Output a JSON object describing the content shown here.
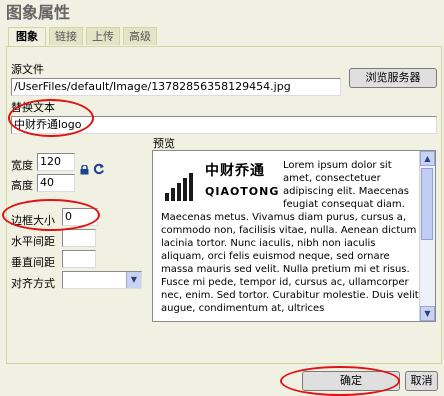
{
  "dialog": {
    "title": "图象属性",
    "tabs": [
      "图象",
      "链接",
      "上传",
      "高级"
    ]
  },
  "image_tab": {
    "source_label": "源文件",
    "source_value": "/UserFiles/default/Image/13782856358129454.jpg",
    "browse_button": "浏览服务器",
    "alt_label": "替换文本",
    "alt_value": "中财乔通logo",
    "width_label": "宽度",
    "width_value": "120",
    "height_label": "高度",
    "height_value": "40",
    "border_label": "边框大小",
    "border_value": "0",
    "hspace_label": "水平间距",
    "hspace_value": "",
    "vspace_label": "垂直间距",
    "vspace_value": "",
    "align_label": "对齐方式",
    "align_value": "",
    "preview_label": "预览"
  },
  "preview": {
    "logo_cn": "中财乔通",
    "logo_en": "QIAOTONG",
    "text": "Lorem ipsum dolor sit amet, consectetuer adipiscing elit. Maecenas feugiat consequat diam. Maecenas metus. Vivamus diam purus, cursus a, commodo non, facilisis vitae, nulla. Aenean dictum lacinia tortor. Nunc iaculis, nibh non iaculis aliquam, orci felis euismod neque, sed ornare massa mauris sed velit. Nulla pretium mi et risus. Fusce mi pede, tempor id, cursus ac, ullamcorper nec, enim. Sed tortor. Curabitur molestie. Duis velit augue, condimentum at, ultrices"
  },
  "footer": {
    "ok_button": "确定",
    "cancel_button": "取消"
  },
  "colors": {
    "highlight": "#e01212",
    "background": "#f1f1e3"
  }
}
